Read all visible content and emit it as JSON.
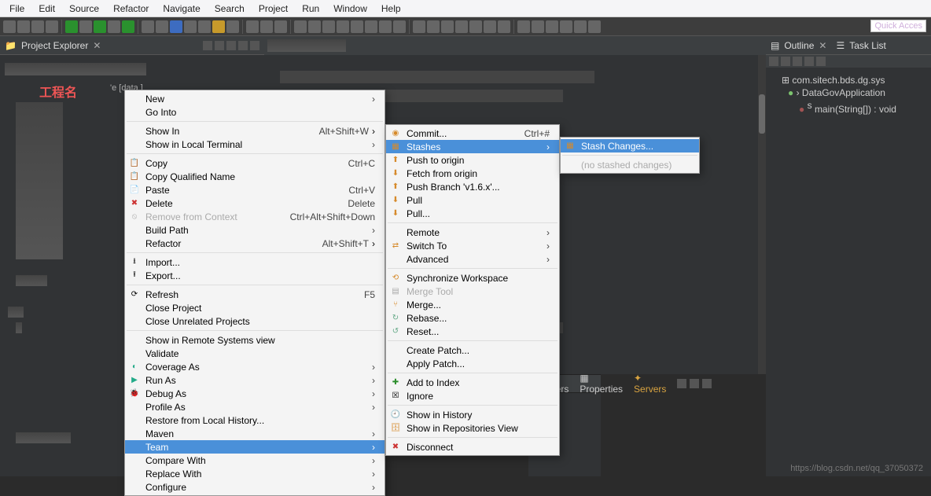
{
  "menubar": [
    "File",
    "Edit",
    "Source",
    "Refactor",
    "Navigate",
    "Search",
    "Project",
    "Run",
    "Window",
    "Help"
  ],
  "quick_access": "Quick Acces",
  "left": {
    "tab_title": "Project Explorer",
    "project_annotation": "工程名",
    "project_path": "'e [data            ]"
  },
  "right": {
    "outline_title": "Outline",
    "tasklist_title": "Task List",
    "nodes": {
      "pkg": "com.sitech.bds.dg.sys",
      "cls": "DataGovApplication",
      "mth": "main(String[]) : void"
    }
  },
  "bottom_tabs": {
    "markers": "Markers",
    "properties": "Properties",
    "servers": "Servers"
  },
  "ctx1": {
    "new": "New",
    "go_into": "Go Into",
    "show_in": "Show In",
    "show_in_kb": "Alt+Shift+W",
    "show_terminal": "Show in Local Terminal",
    "copy": "Copy",
    "copy_kb": "Ctrl+C",
    "copy_qn": "Copy Qualified Name",
    "paste": "Paste",
    "paste_kb": "Ctrl+V",
    "delete": "Delete",
    "delete_kb": "Delete",
    "remove_ctx": "Remove from Context",
    "remove_ctx_kb": "Ctrl+Alt+Shift+Down",
    "build_path": "Build Path",
    "refactor": "Refactor",
    "refactor_kb": "Alt+Shift+T",
    "import": "Import...",
    "export": "Export...",
    "refresh": "Refresh",
    "refresh_kb": "F5",
    "close_proj": "Close Project",
    "close_unrel": "Close Unrelated Projects",
    "show_remote": "Show in Remote Systems view",
    "validate": "Validate",
    "coverage_as": "Coverage As",
    "run_as": "Run As",
    "debug_as": "Debug As",
    "profile_as": "Profile As",
    "restore_lh": "Restore from Local History...",
    "maven": "Maven",
    "team": "Team",
    "compare_with": "Compare With",
    "replace_with": "Replace With",
    "configure": "Configure"
  },
  "ctx2": {
    "commit": "Commit...",
    "commit_kb": "Ctrl+#",
    "stashes": "Stashes",
    "push_origin": "Push to origin",
    "fetch_origin": "Fetch from origin",
    "push_branch": "Push Branch 'v1.6.x'...",
    "pull": "Pull",
    "pull_d": "Pull...",
    "remote": "Remote",
    "switch_to": "Switch To",
    "advanced": "Advanced",
    "sync_ws": "Synchronize Workspace",
    "merge_tool": "Merge Tool",
    "merge": "Merge...",
    "rebase": "Rebase...",
    "reset": "Reset...",
    "create_patch": "Create Patch...",
    "apply_patch": "Apply Patch...",
    "add_index": "Add to Index",
    "ignore": "Ignore",
    "show_history": "Show in History",
    "show_repos": "Show in Repositories View",
    "disconnect": "Disconnect"
  },
  "ctx3": {
    "stash_changes": "Stash Changes...",
    "no_stashed": "(no stashed changes)"
  },
  "watermark": "https://blog.csdn.net/qq_37050372"
}
